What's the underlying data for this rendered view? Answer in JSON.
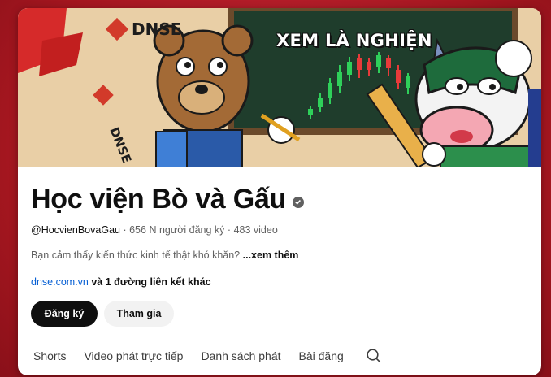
{
  "banner": {
    "headline": "XEM LÀ NGHIỆN",
    "brand": "DNSE",
    "brand_side": "DNSE"
  },
  "channel": {
    "name": "Học viện Bò và Gấu",
    "handle": "@HocvienBovaGau",
    "subscribers": "656 N người đăng ký",
    "videos": "483 video",
    "separator": "·",
    "description": "Bạn cảm thấy kiến thức kinh tế thật khó khăn?",
    "more": "...xem thêm",
    "link_url": "dnse.com.vn",
    "link_extra": "và 1 đường liên kết khác"
  },
  "buttons": {
    "subscribe": "Đăng ký",
    "join": "Tham gia"
  },
  "tabs": [
    "Shorts",
    "Video phát trực tiếp",
    "Danh sách phát",
    "Bài đăng"
  ],
  "icons": {
    "search": "search-icon",
    "verified": "verified-check-icon"
  },
  "colors": {
    "background": "#b81c2a",
    "link": "#065fd4",
    "subscribe_bg": "#0f0f0f"
  }
}
